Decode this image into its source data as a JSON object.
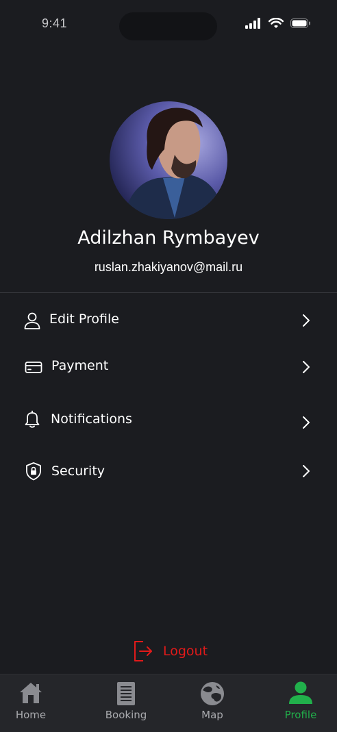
{
  "status": {
    "time": "9:41"
  },
  "profile": {
    "name": "Adilzhan Rymbayev",
    "email": "ruslan.zhakiyanov@mail.ru"
  },
  "menu": [
    {
      "label": "Edit Profile",
      "icon": "user-icon"
    },
    {
      "label": "Payment",
      "icon": "card-icon"
    },
    {
      "label": "Notifications",
      "icon": "bell-icon"
    },
    {
      "label": "Security",
      "icon": "shield-lock-icon"
    }
  ],
  "logout": {
    "label": "Logout",
    "color": "#e11a1a"
  },
  "tabs": [
    {
      "label": "Home",
      "icon": "home-icon",
      "active": false
    },
    {
      "label": "Booking",
      "icon": "document-icon",
      "active": false
    },
    {
      "label": "Map",
      "icon": "globe-icon",
      "active": false
    },
    {
      "label": "Profile",
      "icon": "person-icon",
      "active": true
    }
  ],
  "colors": {
    "background": "#1b1c20",
    "accent": "#21b04b",
    "danger": "#e11a1a",
    "tabbar": "#25262a"
  }
}
